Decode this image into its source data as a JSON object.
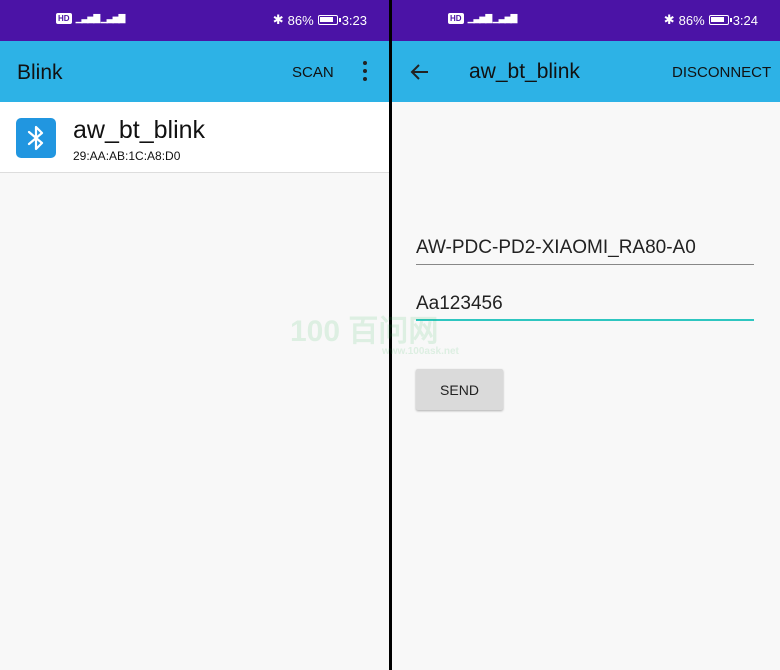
{
  "left": {
    "status": {
      "network": "HD",
      "battery": "86%",
      "time": "3:23"
    },
    "appbar": {
      "title": "Blink",
      "scan_label": "SCAN"
    },
    "device": {
      "name": "aw_bt_blink",
      "address": "29:AA:AB:1C:A8:D0"
    }
  },
  "right": {
    "status": {
      "network": "HD",
      "battery": "86%",
      "time": "3:24"
    },
    "appbar": {
      "title": "aw_bt_blink",
      "disconnect_label": "DISCONNECT"
    },
    "ssid_field": {
      "value": "AW-PDC-PD2-XIAOMI_RA80-A0"
    },
    "password_field": {
      "value": "Aa123456"
    },
    "send_label": "SEND"
  },
  "watermark": {
    "text": "100 百问网",
    "url": "www.100ask.net"
  },
  "colors": {
    "statusbar": "#4b13a6",
    "appbar": "#2db2e6",
    "bt_icon": "#2196e0",
    "focus_line": "#2ec6c0"
  }
}
